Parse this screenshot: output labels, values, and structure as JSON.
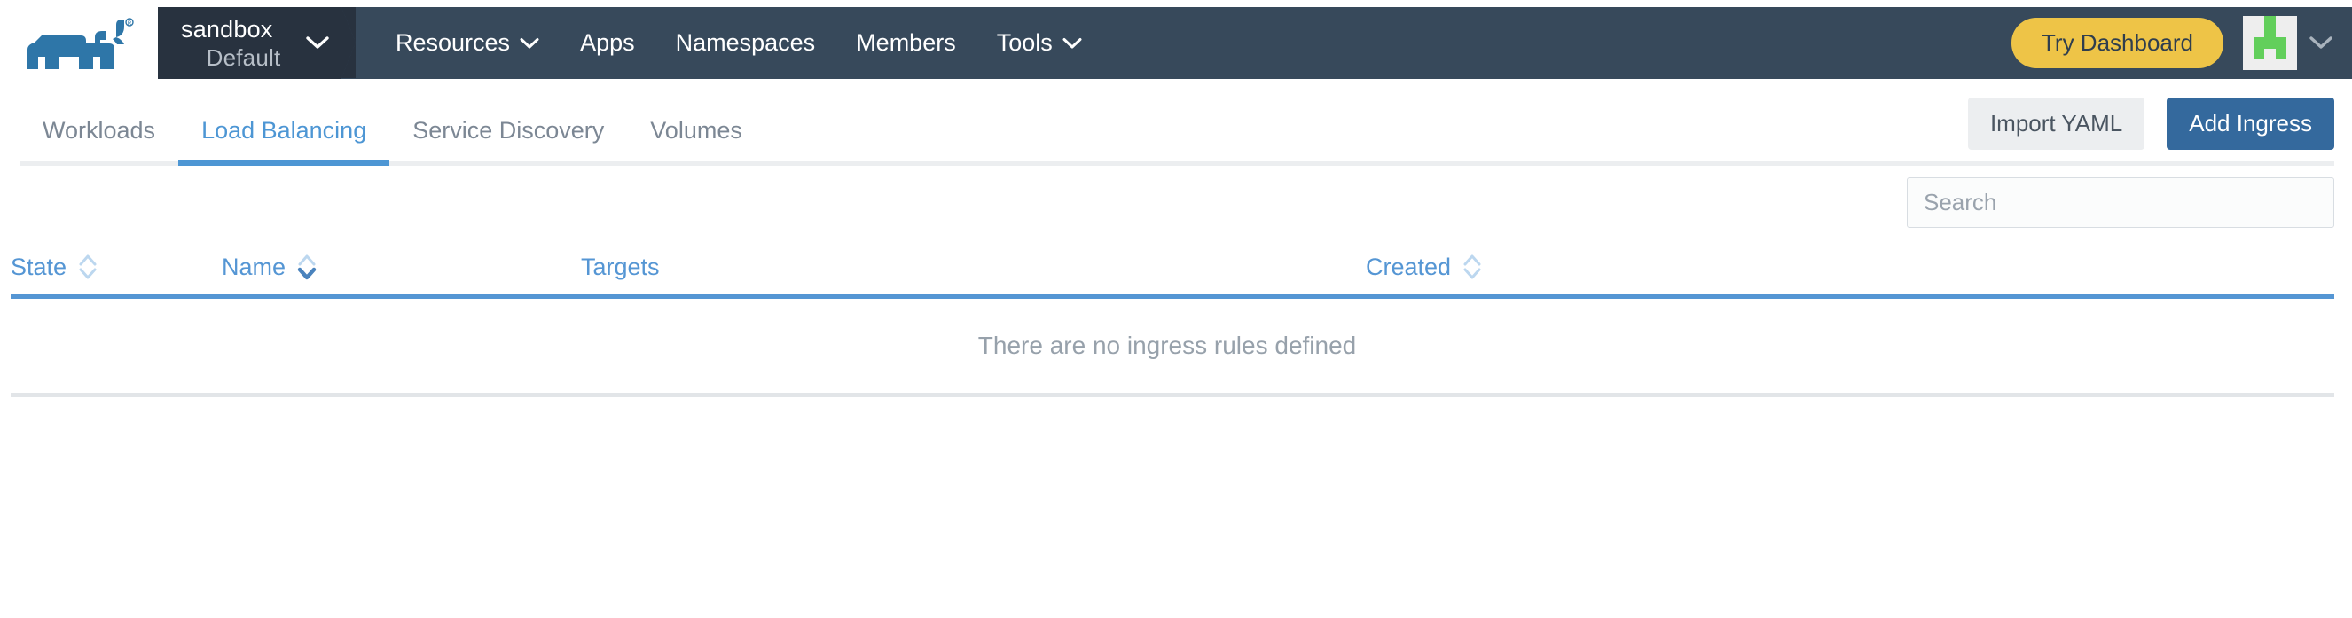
{
  "header": {
    "logo_icon": "rancher-cow-logo",
    "cluster": {
      "name": "sandbox",
      "project": "Default",
      "caret_icon": "chevron-down-icon"
    },
    "nav": [
      {
        "label": "Resources",
        "has_caret": true,
        "caret_icon": "chevron-down-icon"
      },
      {
        "label": "Apps",
        "has_caret": false,
        "caret_icon": ""
      },
      {
        "label": "Namespaces",
        "has_caret": false,
        "caret_icon": ""
      },
      {
        "label": "Members",
        "has_caret": false,
        "caret_icon": ""
      },
      {
        "label": "Tools",
        "has_caret": true,
        "caret_icon": "chevron-down-icon"
      }
    ],
    "try_dashboard_label": "Try Dashboard",
    "avatar": {
      "icon": "user-identicon-avatar",
      "caret_icon": "chevron-down-icon",
      "cells": [
        0,
        0,
        1,
        0,
        0,
        0,
        0,
        1,
        0,
        0,
        0,
        1,
        1,
        1,
        0,
        0,
        1,
        0,
        1,
        0,
        0,
        0,
        0,
        0,
        0
      ],
      "color": "#62cf5b",
      "background": "#eeeeee"
    },
    "colors": {
      "navbar": "#37495b",
      "cluster_block": "#28323f",
      "try_dashboard": "#eec447"
    }
  },
  "tabs": {
    "items": [
      {
        "label": "Workloads",
        "active": false
      },
      {
        "label": "Load Balancing",
        "active": true
      },
      {
        "label": "Service Discovery",
        "active": false
      },
      {
        "label": "Volumes",
        "active": false
      }
    ],
    "active_color": "#4d96d4",
    "actions": {
      "import_yaml_label": "Import YAML",
      "add_ingress_label": "Add Ingress"
    }
  },
  "search": {
    "value": "",
    "placeholder": "Search"
  },
  "table": {
    "columns": [
      {
        "label": "State",
        "sortable": true,
        "sort": "none"
      },
      {
        "label": "Name",
        "sortable": true,
        "sort": "desc"
      },
      {
        "label": "Targets",
        "sortable": false,
        "sort": "none"
      },
      {
        "label": "Created",
        "sortable": true,
        "sort": "none"
      }
    ],
    "rows": [],
    "empty_message": "There are no ingress rules defined",
    "header_color": "#5596d4"
  }
}
